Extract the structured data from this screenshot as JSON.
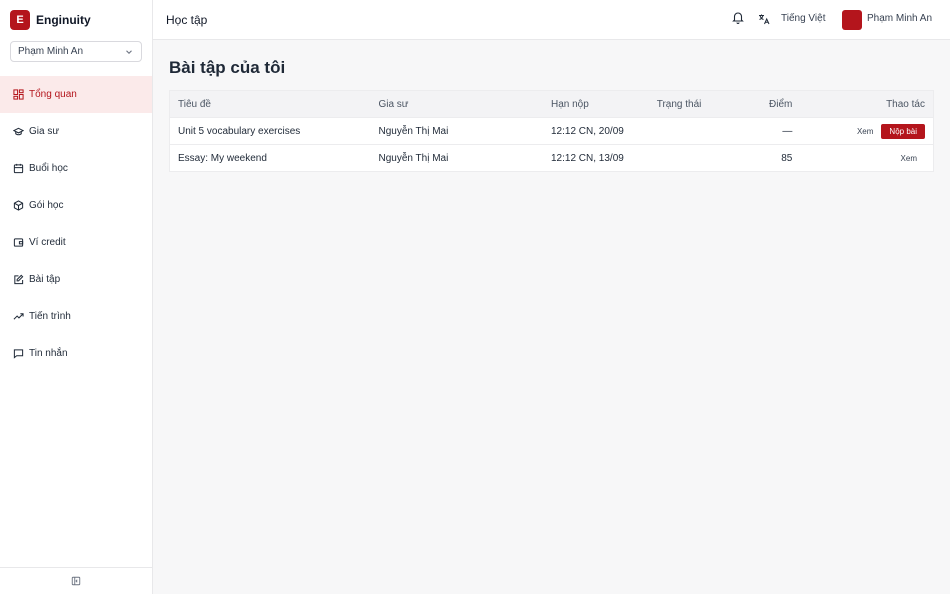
{
  "brand": {
    "logo_letter": "E",
    "name": "Enginuity"
  },
  "user_select": {
    "value": "Phạm Minh An"
  },
  "nav": [
    {
      "label": "Tổng quan",
      "icon": "dashboard-icon"
    },
    {
      "label": "Gia sư",
      "icon": "graduation-cap-icon"
    },
    {
      "label": "Buổi học",
      "icon": "calendar-icon"
    },
    {
      "label": "Gói học",
      "icon": "package-icon"
    },
    {
      "label": "Ví credit",
      "icon": "wallet-icon"
    },
    {
      "label": "Bài tập",
      "icon": "edit-icon"
    },
    {
      "label": "Tiến trình",
      "icon": "trending-up-icon"
    },
    {
      "label": "Tin nhắn",
      "icon": "message-icon"
    }
  ],
  "topbar": {
    "crumb": "Học tập",
    "language": "Tiếng Việt",
    "user": "Phạm Minh An"
  },
  "main": {
    "title": "Bài tập của tôi",
    "columns": [
      "Tiêu đề",
      "Gia sư",
      "Hạn nộp",
      "Trạng thái",
      "Điểm",
      "Thao tác"
    ],
    "rows": [
      {
        "title": "Unit 5 vocabulary exercises",
        "tutor": "Nguyễn Thị Mai",
        "due": "12:12 CN, 20/09",
        "status": "",
        "score": "—",
        "view": "Xem",
        "submit": "Nộp bài"
      },
      {
        "title": "Essay: My weekend",
        "tutor": "Nguyễn Thị Mai",
        "due": "12:12 CN, 13/09",
        "status": "",
        "score": "85",
        "view": "Xem"
      }
    ]
  },
  "colors": {
    "accent": "#b4151c",
    "active_bg": "#fbeaea"
  }
}
